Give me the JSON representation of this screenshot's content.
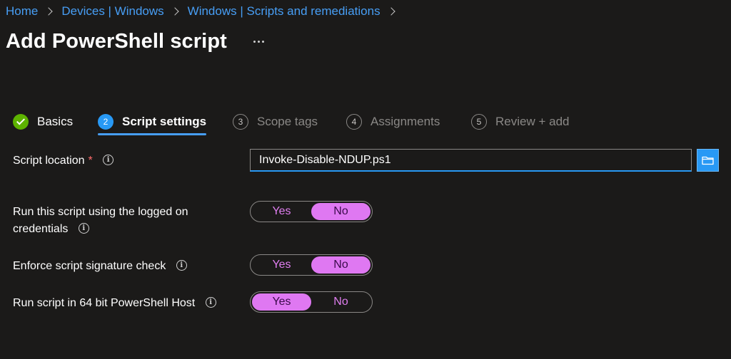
{
  "breadcrumb": {
    "items": [
      "Home",
      "Devices | Windows",
      "Windows | Scripts and remediations"
    ]
  },
  "page": {
    "title": "Add PowerShell script",
    "more_icon": "more-horizontal-icon"
  },
  "wizard": {
    "steps": [
      {
        "number": "1",
        "label": "Basics",
        "state": "completed"
      },
      {
        "number": "2",
        "label": "Script settings",
        "state": "current"
      },
      {
        "number": "3",
        "label": "Scope tags",
        "state": "upcoming"
      },
      {
        "number": "4",
        "label": "Assignments",
        "state": "upcoming"
      },
      {
        "number": "5",
        "label": "Review + add",
        "state": "upcoming"
      }
    ]
  },
  "form": {
    "script_location": {
      "label": "Script location",
      "required_mark": "*",
      "value": "Invoke-Disable-NDUP.ps1",
      "browse_icon": "folder-icon"
    },
    "run_logged_on": {
      "label_line1": "Run this script using the logged on",
      "label_line2": "credentials",
      "yes": "Yes",
      "no": "No",
      "selected": "No"
    },
    "signature_check": {
      "label": "Enforce script signature check",
      "yes": "Yes",
      "no": "No",
      "selected": "No"
    },
    "run_64bit": {
      "label": "Run script in 64 bit PowerShell Host",
      "yes": "Yes",
      "no": "No",
      "selected": "Yes"
    },
    "info_glyph": "i"
  },
  "colors": {
    "background": "#1b1a19",
    "link": "#479ef5",
    "accent": "#2899f5",
    "success": "#5db300",
    "toggle_selected": "#df78f2"
  }
}
